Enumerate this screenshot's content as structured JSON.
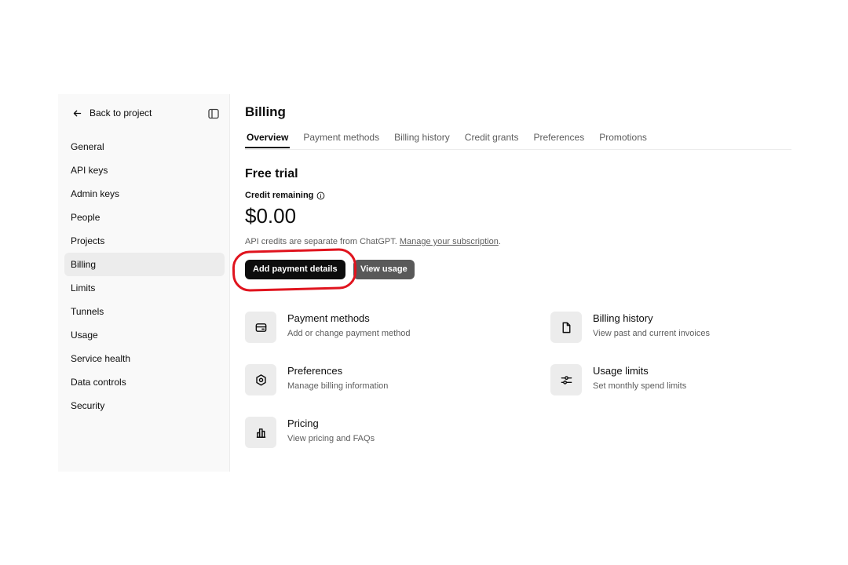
{
  "sidebar": {
    "back_label": "Back to project",
    "items": [
      {
        "label": "General"
      },
      {
        "label": "API keys"
      },
      {
        "label": "Admin keys"
      },
      {
        "label": "People"
      },
      {
        "label": "Projects"
      },
      {
        "label": "Billing",
        "active": true
      },
      {
        "label": "Limits"
      },
      {
        "label": "Tunnels"
      },
      {
        "label": "Usage"
      },
      {
        "label": "Service health"
      },
      {
        "label": "Data controls"
      },
      {
        "label": "Security"
      }
    ]
  },
  "page": {
    "title": "Billing",
    "tabs": [
      {
        "label": "Overview",
        "active": true
      },
      {
        "label": "Payment methods"
      },
      {
        "label": "Billing history"
      },
      {
        "label": "Credit grants"
      },
      {
        "label": "Preferences"
      },
      {
        "label": "Promotions"
      }
    ]
  },
  "overview": {
    "plan_title": "Free trial",
    "credit_label": "Credit remaining",
    "credit_amount": "$0.00",
    "note_text": "API credits are separate from ChatGPT. ",
    "note_link": "Manage your subscription",
    "note_end": ".",
    "add_payment_label": "Add payment details",
    "view_usage_label": "View usage"
  },
  "cards": [
    {
      "title": "Payment methods",
      "desc": "Add or change payment method",
      "icon": "credit-card-icon"
    },
    {
      "title": "Billing history",
      "desc": "View past and current invoices",
      "icon": "document-icon"
    },
    {
      "title": "Preferences",
      "desc": "Manage billing information",
      "icon": "gear-icon"
    },
    {
      "title": "Usage limits",
      "desc": "Set monthly spend limits",
      "icon": "sliders-icon"
    },
    {
      "title": "Pricing",
      "desc": "View pricing and FAQs",
      "icon": "chart-icon"
    }
  ],
  "colors": {
    "annotation_ring": "#e0141e",
    "primary_button": "#0d0d0d",
    "secondary_button": "#595959"
  }
}
